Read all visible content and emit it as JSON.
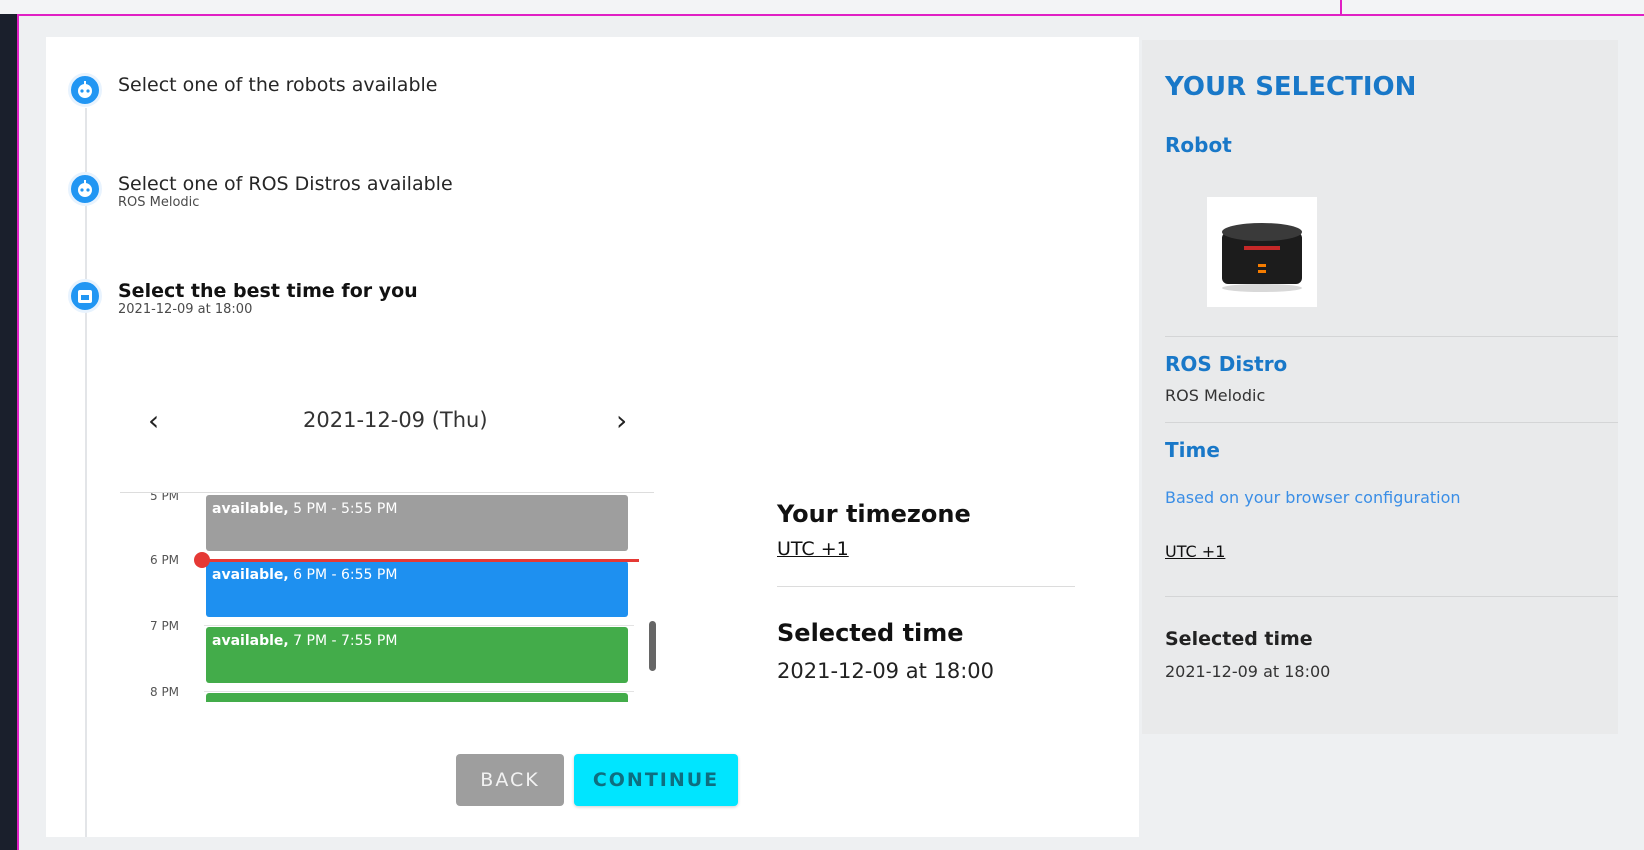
{
  "steps": [
    {
      "title": "Select one of the robots available",
      "sub": ""
    },
    {
      "title": "Select one of ROS Distros available",
      "sub": "ROS Melodic"
    },
    {
      "title": "Select the best time for you",
      "sub": "2021-12-09 at 18:00"
    }
  ],
  "date_nav": {
    "prev": "‹",
    "date": "2021-12-09 (Thu)",
    "next": "›"
  },
  "calendar": {
    "hours": [
      "5 PM",
      "6 PM",
      "7 PM",
      "8 PM"
    ],
    "events": [
      {
        "status": "available,",
        "range": "5 PM - 5:55 PM",
        "color": "#9e9e9e"
      },
      {
        "status": "available,",
        "range": "6 PM - 6:55 PM",
        "color": "#1e90f0"
      },
      {
        "status": "available,",
        "range": "7 PM - 7:55 PM",
        "color": "#43ac4a"
      }
    ]
  },
  "timezone": {
    "title": "Your timezone",
    "value": "UTC +1"
  },
  "selected": {
    "title": "Selected time",
    "value": "2021-12-09 at 18:00"
  },
  "buttons": {
    "back": "BACK",
    "continue": "CONTINUE"
  },
  "panel": {
    "title": "YOUR SELECTION",
    "robot_label": "Robot",
    "ros_label": "ROS Distro",
    "ros_value": "ROS Melodic",
    "time_label": "Time",
    "time_note": "Based on your browser configuration",
    "utc": "UTC +1",
    "selected_label": "Selected time",
    "selected_value": "2021-12-09 at 18:00"
  },
  "colors": {
    "accent": "#1978c8",
    "continue": "#00e5ff",
    "frame": "#e01fc4"
  }
}
